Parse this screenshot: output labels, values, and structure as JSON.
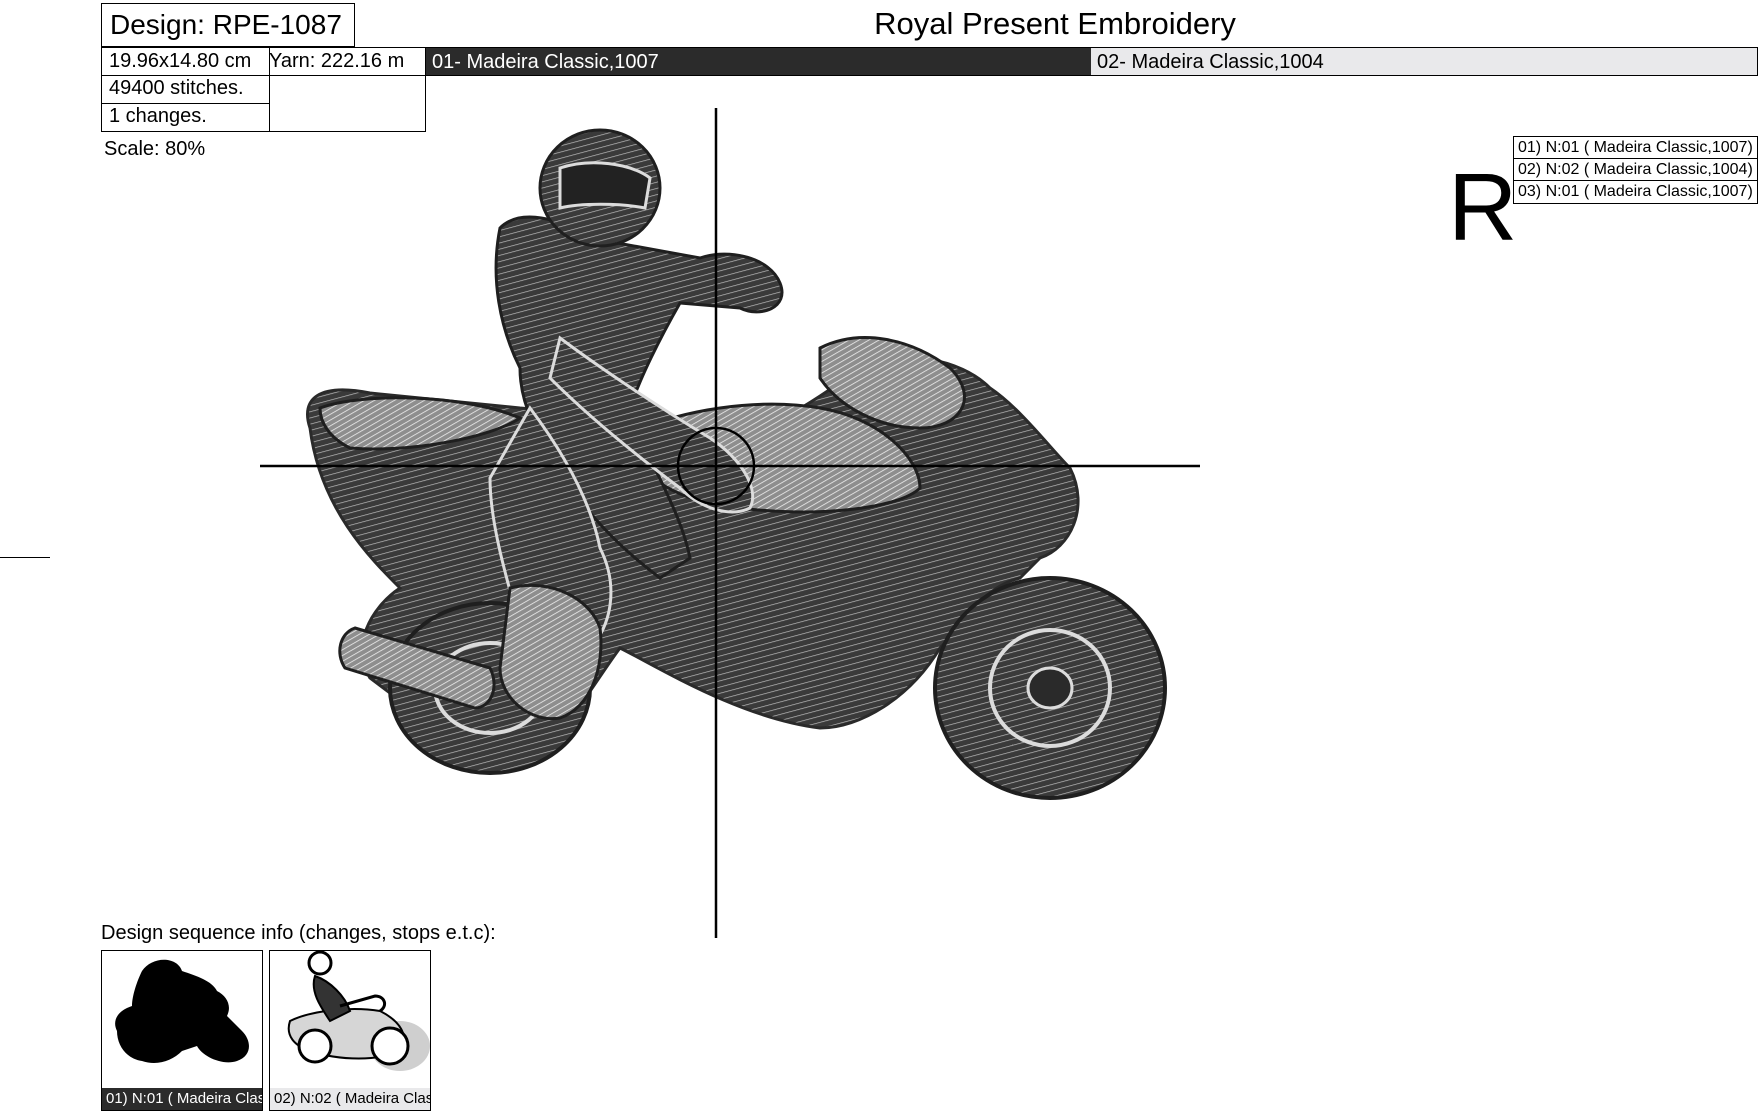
{
  "design": {
    "title": "Design: RPE-1087"
  },
  "header": {
    "title": "Royal Present Embroidery"
  },
  "stats": {
    "size": "19.96x14.80 cm",
    "yarn": "Yarn: 222.16 m",
    "stitches": "49400 stitches.",
    "changes": "1 changes."
  },
  "threads": [
    {
      "label": "01- Madeira Classic,1007",
      "color": "#2b2b2b"
    },
    {
      "label": "02- Madeira Classic,1004",
      "color": "#e9e9eb"
    }
  ],
  "scale": "Scale: 80%",
  "corner_letter": "R",
  "legend": [
    "01) N:01 ( Madeira Classic,1007)",
    "02) N:02 ( Madeira Classic,1004)",
    "03) N:01 ( Madeira Classic,1007)"
  ],
  "sequence": {
    "label": "Design sequence info (changes, stops e.t.c):",
    "thumbnails": [
      {
        "caption": "01) N:01 ( Madeira Clas",
        "style": "dark"
      },
      {
        "caption": "02) N:02 ( Madeira Clas",
        "style": "light"
      }
    ]
  },
  "design_image": {
    "icon": "motorcycle-rider-embroidery-icon"
  }
}
